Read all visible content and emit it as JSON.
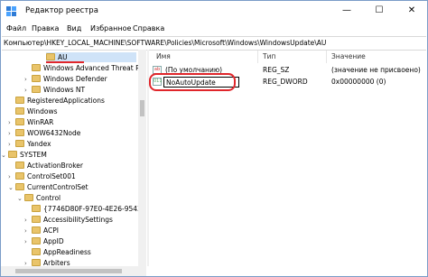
{
  "window": {
    "title": "Редактор реестра",
    "controls": {
      "minimize": "—",
      "maximize": "☐",
      "close": "✕"
    }
  },
  "menu": [
    "Файл",
    "Правка",
    "Вид",
    "Избранное",
    "Справка"
  ],
  "address": "Компьютер\\HKEY_LOCAL_MACHINE\\SOFTWARE\\Policies\\Microsoft\\Windows\\WindowsUpdate\\AU",
  "tree": [
    {
      "label": "AU",
      "selected": true
    },
    {
      "label": "Windows Advanced Threat Pro"
    },
    {
      "label": "Windows Defender",
      "arrow": "›"
    },
    {
      "label": "Windows NT",
      "arrow": "›"
    },
    {
      "label": "RegisteredApplications"
    },
    {
      "label": "Windows"
    },
    {
      "label": "WinRAR",
      "arrow": "›"
    },
    {
      "label": "WOW6432Node",
      "arrow": "›"
    },
    {
      "label": "Yandex",
      "arrow": "›"
    },
    {
      "label": "SYSTEM",
      "arrow": "⌄"
    },
    {
      "label": "ActivationBroker"
    },
    {
      "label": "ControlSet001",
      "arrow": "›"
    },
    {
      "label": "CurrentControlSet",
      "arrow": "⌄"
    },
    {
      "label": "Control",
      "arrow": "⌄"
    },
    {
      "label": "{7746D80F-97E0-4E26-9543-26E"
    },
    {
      "label": "AccessibilitySettings",
      "arrow": "›"
    },
    {
      "label": "ACPI",
      "arrow": "›"
    },
    {
      "label": "AppID",
      "arrow": "›"
    },
    {
      "label": "AppReadiness"
    },
    {
      "label": "Arbiters",
      "arrow": "›"
    }
  ],
  "list": {
    "headers": {
      "name": "Имя",
      "type": "Тип",
      "value": "Значение"
    },
    "rows": [
      {
        "icon": "ab",
        "name": "(По умолчанию)",
        "type": "REG_SZ",
        "value": "(значение не присвоено)"
      },
      {
        "icon": "011",
        "name": "NoAutoUpdate",
        "type": "REG_DWORD",
        "value": "0x00000000 (0)"
      }
    ]
  }
}
